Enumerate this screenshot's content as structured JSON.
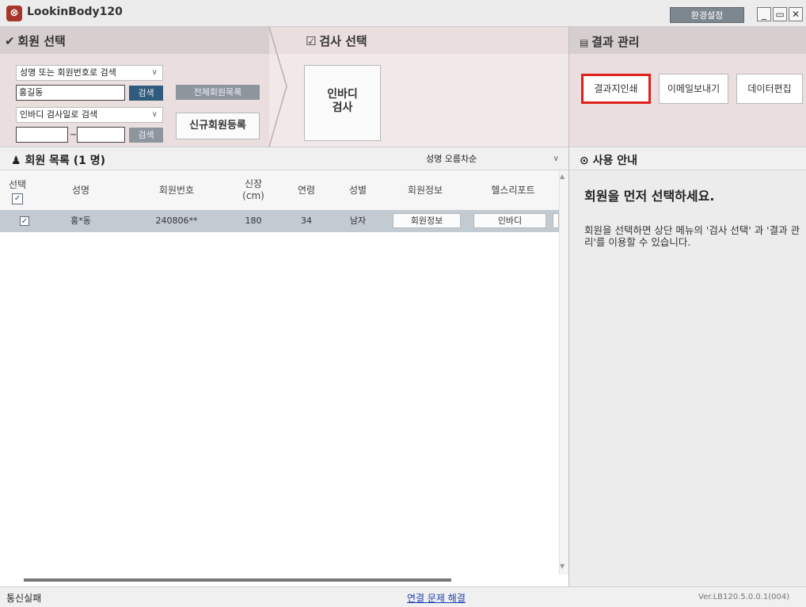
{
  "app": {
    "title": "LookinBody120",
    "settings_label": "환경설정",
    "minimize": "_",
    "maximize": "▭",
    "close": "✕"
  },
  "member_select": {
    "header": "회원 선택",
    "search_mode": "성명 또는 회원번호로 검색",
    "search_value": "홍길동",
    "search_button": "검색",
    "all_members_button": "전체회원목록",
    "date_mode": "인바디 검사일로 검색",
    "date_separator": "~",
    "date_search_button": "검색",
    "new_member_button": "신규회원등록"
  },
  "test_select": {
    "header": "검사 선택",
    "inbody_button_line1": "인바디",
    "inbody_button_line2": "검사"
  },
  "result_manage": {
    "header": "결과 관리",
    "buttons": [
      "결과지인쇄",
      "이메일보내기",
      "데이터편집"
    ]
  },
  "member_list": {
    "header": "회원 목록",
    "count": "(1 명)",
    "sort": "성명 오름차순",
    "columns": {
      "select": "선택",
      "name": "성명",
      "member_no": "회원번호",
      "height_l1": "신장",
      "height_l2": "(cm)",
      "age": "연령",
      "gender": "성별",
      "member_info": "회원정보",
      "health_report": "헬스리포트"
    },
    "rows": [
      {
        "name": "홍*동",
        "member_no": "240806**",
        "height": "180",
        "age": "34",
        "gender": "남자",
        "info_button": "회원정보",
        "report_button": "인바디"
      }
    ]
  },
  "guide": {
    "header": "사용 안내",
    "title": "회원을 먼저 선택하세요.",
    "body": "회원을 선택하면 상단 메뉴의 '검사 선택' 과 '결과 관리'를 이용할 수 있습니다."
  },
  "status": {
    "left": "통신실패",
    "link": "연결 문제 해결",
    "version": "Ver.LB120.5.0.0.1(004)"
  },
  "colors": {
    "highlight": "#e0201b",
    "header_bg": "#d7cfcf",
    "button_dark": "#2f5b7c",
    "selected_row": "#c2cad2"
  }
}
